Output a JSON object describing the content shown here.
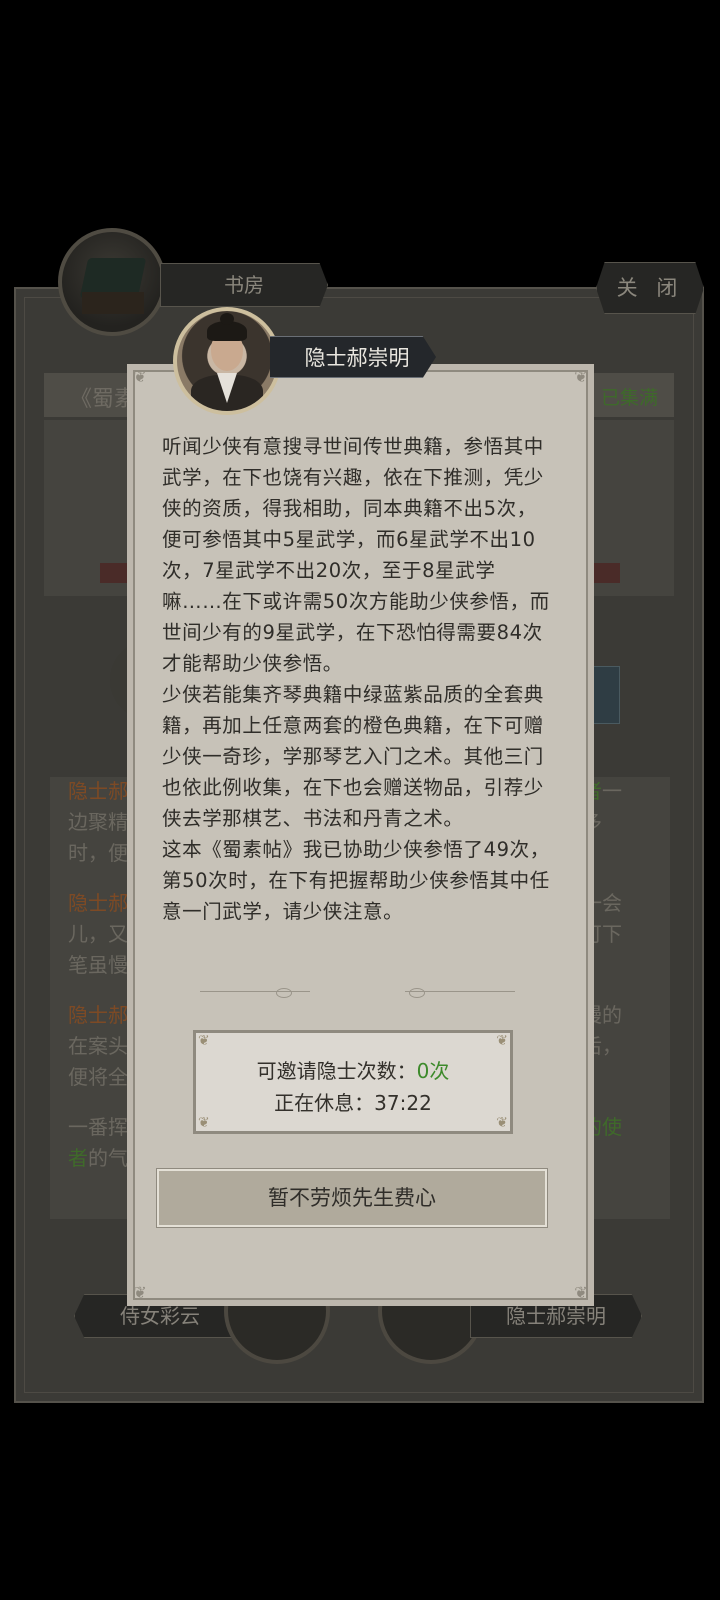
{
  "background": {
    "study_title": "书房",
    "close_label": "关 闭",
    "book_title_partial": "《蜀素",
    "collected_status": "已集满",
    "log_rows": [
      {
        "speaker": "隐士郝",
        "tail": "者一"
      },
      {
        "speaker": "",
        "text": "边聚精",
        "tail": "多"
      },
      {
        "speaker": "",
        "text": "时，便"
      },
      {
        "speaker": "隐士郝",
        "tail": "一会"
      },
      {
        "speaker": "",
        "text": "儿，又",
        "tail": "可下"
      },
      {
        "speaker": "",
        "text": "笔虽慢"
      },
      {
        "speaker": "隐士郝",
        "tail": "慢的"
      },
      {
        "speaker": "",
        "text": "在案头",
        "tail": "后，"
      },
      {
        "speaker": "",
        "text": "便将全"
      },
      {
        "speaker": "",
        "text": "一番挥",
        "tail": "的使"
      },
      {
        "speaker": "",
        "text": "者",
        "tail2": "的气"
      }
    ],
    "bottom_left_name": "侍女彩云",
    "bottom_right_name": "隐士郝崇明"
  },
  "dialog": {
    "npc_name": "隐士郝崇明",
    "paragraphs": [
      "听闻少侠有意搜寻世间传世典籍，参悟其中武学，在下也饶有兴趣，依在下推测，凭少侠的资质，得我相助，同本典籍不出5次，便可参悟其中5星武学，而6星武学不出10次，7星武学不出20次，至于8星武学嘛……在下或许需50次方能助少侠参悟，而世间少有的9星武学，在下恐怕得需要84次才能帮助少侠参悟。",
      "少侠若能集齐琴典籍中绿蓝紫品质的全套典籍，再加上任意两套的橙色典籍，在下可赠少侠一奇珍，学那琴艺入门之术。其他三门也依此例收集，在下也会赠送物品，引荐少侠去学那棋艺、书法和丹青之术。",
      "这本《蜀素帖》我已协助少侠参悟了49次，第50次时，在下有把握帮助少侠参悟其中任意一门武学，请少侠注意。"
    ],
    "invite_label": "可邀请隐士次数：",
    "invite_value": "0次",
    "resting_label": "正在休息：",
    "resting_time": "37:22",
    "decline_button": "暂不劳烦先生费心"
  },
  "colors": {
    "accent_green": "#3d8a2b",
    "ribbon_dark": "#24272b",
    "dialog_bg": "#c7c2b8"
  }
}
